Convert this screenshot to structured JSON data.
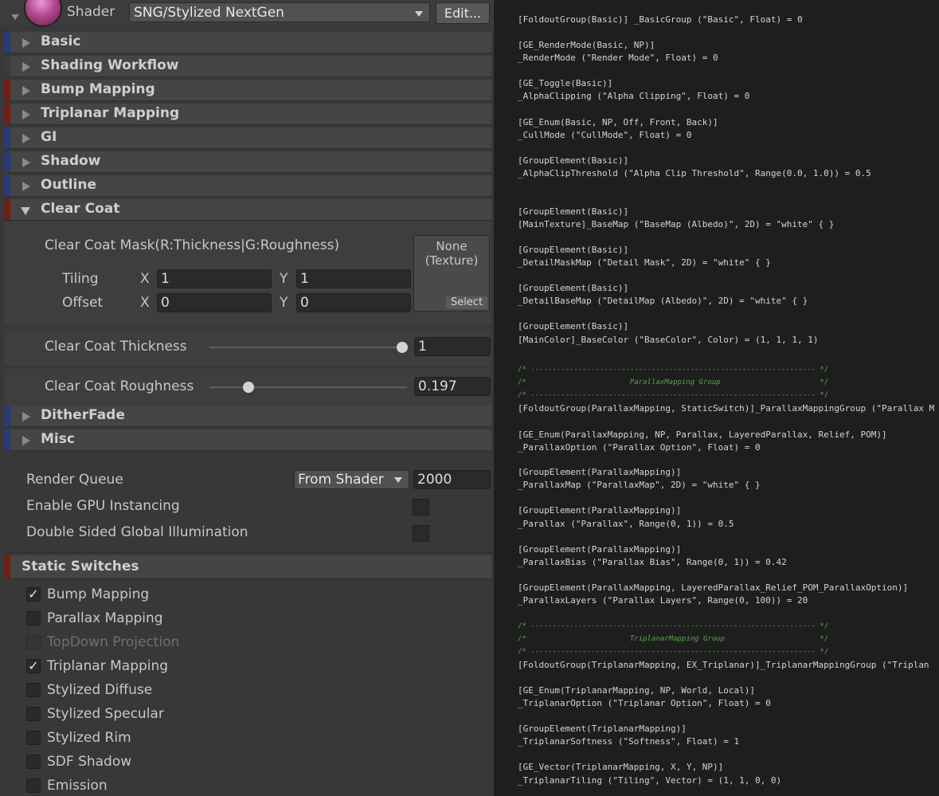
{
  "header": {
    "shader_label": "Shader",
    "shader_value": "SNG/Stylized NextGen",
    "edit_label": "Edit..."
  },
  "groups": {
    "basic": "Basic",
    "shading": "Shading Workflow",
    "bump": "Bump Mapping",
    "triplanar": "Triplanar Mapping",
    "gi": "GI",
    "shadow": "Shadow",
    "outline": "Outline",
    "clearcoat": "Clear Coat",
    "dither": "DitherFade",
    "misc": "Misc"
  },
  "clear_coat": {
    "mask_label": "Clear Coat Mask(R:Thickness|G:Roughness)",
    "tiling_label": "Tiling",
    "offset_label": "Offset",
    "x_label": "X",
    "y_label": "Y",
    "tiling_x": "1",
    "tiling_y": "1",
    "offset_x": "0",
    "offset_y": "0",
    "texture_none": "None",
    "texture_type": "(Texture)",
    "select_label": "Select",
    "thickness_label": "Clear Coat Thickness",
    "thickness_value": "1",
    "thickness_fraction": 1.0,
    "roughness_label": "Clear Coat Roughness",
    "roughness_value": "0.197",
    "roughness_fraction": 0.197
  },
  "settings": {
    "render_queue_label": "Render Queue",
    "render_queue_mode": "From Shader",
    "render_queue_value": "2000",
    "gpu_instancing_label": "Enable GPU Instancing",
    "double_sided_gi_label": "Double Sided Global Illumination"
  },
  "static_switches": {
    "title": "Static Switches",
    "items": [
      {
        "label": "Bump Mapping",
        "checked": "✓"
      },
      {
        "label": "Parallax Mapping",
        "checked": ""
      },
      {
        "label": "TopDown Projection",
        "checked": ""
      },
      {
        "label": "Triplanar Mapping",
        "checked": "✓"
      },
      {
        "label": "Stylized Diffuse",
        "checked": ""
      },
      {
        "label": "Stylized Specular",
        "checked": ""
      },
      {
        "label": "Stylized Rim",
        "checked": ""
      },
      {
        "label": "SDF Shadow",
        "checked": ""
      },
      {
        "label": "Emission",
        "checked": ""
      }
    ]
  },
  "code_lines": [
    "[FoldoutGroup(Basic)] _BasicGroup (\"Basic\", Float) = 0",
    "[GE_RenderMode(Basic, NP)]",
    "_RenderMode (\"Render Mode\", Float) = 0",
    "[GE_Toggle(Basic)]",
    "_AlphaClipping (\"Alpha Clipping\", Float) = 0",
    "[GE_Enum(Basic, NP, Off, Front, Back)]",
    "_CullMode (\"CullMode\", Float) = 0",
    "[GroupElement(Basic)]",
    "_AlphaClipThreshold (\"Alpha Clip Threshold\", Range(0.0, 1.0)) = 0.5",
    "[GroupElement(Basic)]",
    "[MainTexture]_BaseMap (\"BaseMap (Albedo)\", 2D) = \"white\" { }",
    "[GroupElement(Basic)]",
    "_DetailMaskMap (\"Detail Mask\", 2D) = \"white\" { }",
    "[GroupElement(Basic)]",
    "_DetailBaseMap (\"DetailMap (Albedo)\", 2D) = \"white\" { }",
    "[GroupElement(Basic)]",
    "[MainColor]_BaseColor (\"BaseColor\", Color) = (1, 1, 1, 1)",
    "/* ------------------------------------------------------------------ */",
    "/*                        ParallaxMapping Group                       */",
    "/* ------------------------------------------------------------------ */",
    "[FoldoutGroup(ParallaxMapping, StaticSwitch)]_ParallaxMappingGroup (\"Parallax M",
    "[GE_Enum(ParallaxMapping, NP, Parallax, LayeredParallax, Relief, POM)]",
    "_ParallaxOption (\"Parallax Option\", Float) = 0",
    "[GroupElement(ParallaxMapping)]",
    "_ParallaxMap (\"ParallaxMap\", 2D) = \"white\" { }",
    "[GroupElement(ParallaxMapping)]",
    "_Parallax (\"Parallax\", Range(0, 1)) = 0.5",
    "[GroupElement(ParallaxMapping)]",
    "_ParallaxBias (\"Parallax Bias\", Range(0, 1)) = 0.42",
    "[GroupElement(ParallaxMapping, LayeredParallax_Relief_POM_ParallaxOption)]",
    "_ParallaxLayers (\"Parallax Layers\", Range(0, 100)) = 20",
    "/* ------------------------------------------------------------------ */",
    "/*                        TriplanarMapping Group                      */",
    "/* ------------------------------------------------------------------ */",
    "[FoldoutGroup(TriplanarMapping, EX_Triplanar)]_TriplanarMappingGroup (\"Triplan",
    "[GE_Enum(TriplanarMapping, NP, World, Local)]",
    "_TriplanarOption (\"Triplanar Option\", Float) = 0",
    "[GroupElement(TriplanarMapping)]",
    "_TriplanarSoftness (\"Softness\", Float) = 1",
    "[GE_Vector(TriplanarMapping, X, Y, NP)]",
    "_TriplanarTiling (\"Tiling\", Vector) = (1, 1, 0, 0)"
  ]
}
